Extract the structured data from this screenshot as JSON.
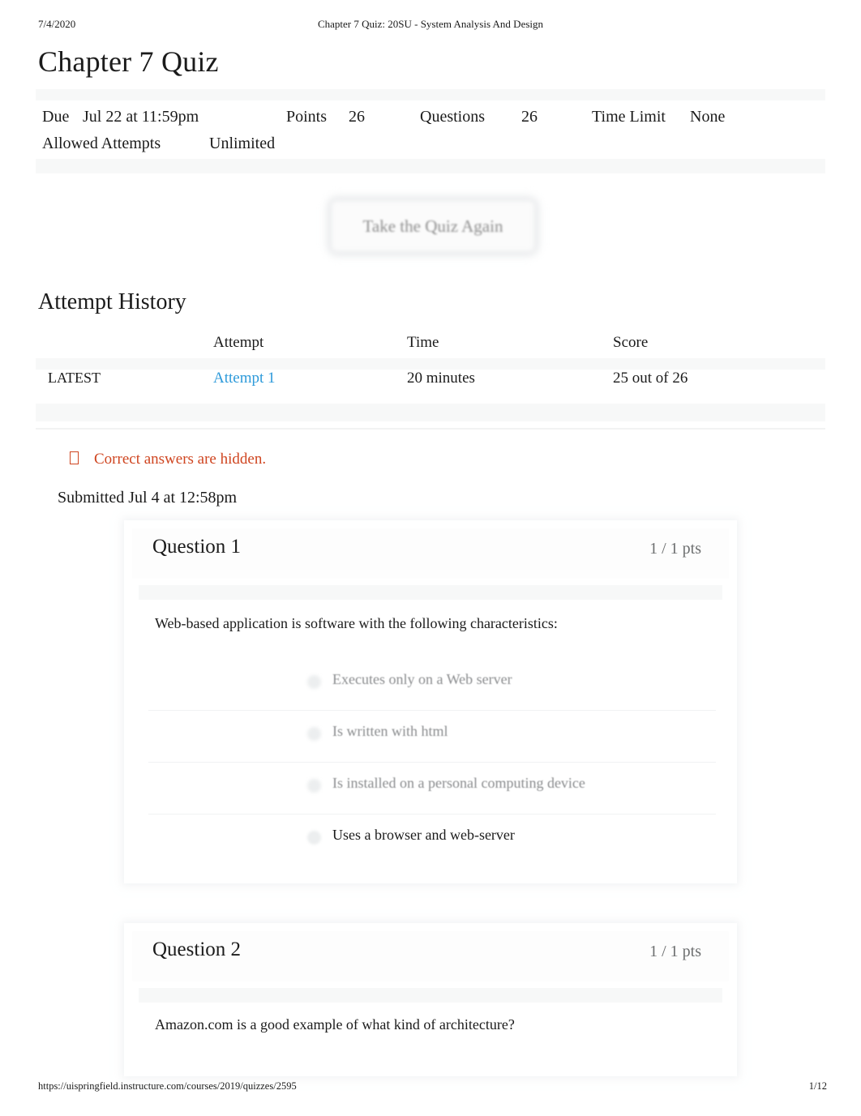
{
  "print": {
    "date": "7/4/2020",
    "doc_title": "Chapter 7 Quiz: 20SU - System Analysis And Design",
    "url": "https://uispringfield.instructure.com/courses/2019/quizzes/2595",
    "page": "1/12"
  },
  "quiz": {
    "title": "Chapter 7 Quiz",
    "meta": {
      "due_label": "Due",
      "due_value": "Jul 22 at 11:59pm",
      "points_label": "Points",
      "points_value": "26",
      "questions_label": "Questions",
      "questions_value": "26",
      "time_limit_label": "Time Limit",
      "time_limit_value": "None",
      "allowed_attempts_label": "Allowed Attempts",
      "allowed_attempts_value": "Unlimited"
    },
    "retake_button": "Take the Quiz Again"
  },
  "attempt_history": {
    "heading": "Attempt History",
    "columns": [
      "",
      "Attempt",
      "Time",
      "Score"
    ],
    "rows": [
      {
        "kind": "LATEST",
        "attempt": "Attempt 1",
        "time": "20 minutes",
        "score": "25 out of 26"
      }
    ]
  },
  "notice": {
    "icon": "info-icon",
    "text": "Correct answers are hidden.",
    "color": "#cf4520"
  },
  "submitted": "Submitted Jul 4 at 12:58pm",
  "questions": [
    {
      "title": "Question 1",
      "points": "1 / 1 pts",
      "prompt": "Web-based application is software with the following characteristics:",
      "answers": [
        {
          "text": "Executes only on a Web server",
          "selected": false
        },
        {
          "text": "Is written with html",
          "selected": false
        },
        {
          "text": "Is installed on a personal computing device",
          "selected": false
        },
        {
          "text": "Uses a browser and web-server",
          "selected": true
        }
      ]
    },
    {
      "title": "Question 2",
      "points": "1 / 1 pts",
      "prompt": "Amazon.com is a good example of what kind of architecture?",
      "answers": []
    }
  ],
  "colors": {
    "link": "#2d9ada",
    "warning": "#cf4520",
    "text": "#1b1b1b",
    "muted": "#8b8d8f"
  }
}
